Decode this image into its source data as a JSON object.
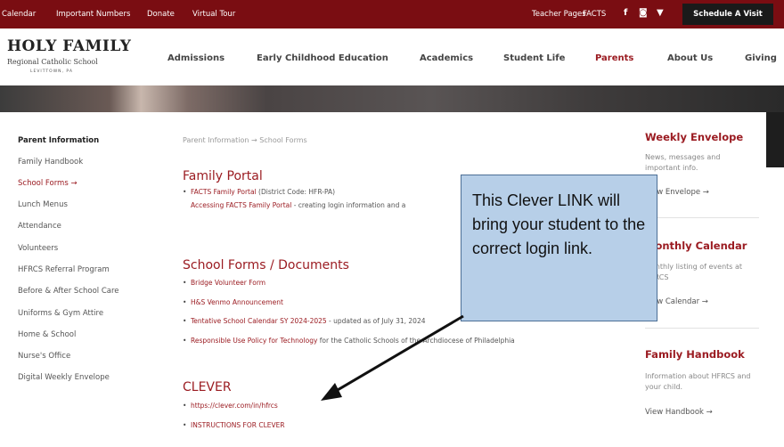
{
  "topbar": {
    "links": [
      "Calendar",
      "Important Numbers",
      "Donate",
      "Virtual Tour"
    ],
    "right_links": [
      "Teacher Pages",
      "FACTS"
    ],
    "social_icons": [
      "facebook-icon",
      "instagram-icon",
      "twitter-icon"
    ],
    "social_glyphs": [
      "f",
      "◙",
      "▼"
    ],
    "cta": "Schedule A Visit"
  },
  "logo": {
    "name": "HOLY FAMILY",
    "subtitle": "Regional Catholic School",
    "location": "LEVITTOWN, PA"
  },
  "nav": [
    "Admissions",
    "Early Childhood Education",
    "Academics",
    "Student Life",
    "Parents",
    "About Us",
    "Giving"
  ],
  "sidebar": {
    "heading": "Parent Information",
    "items": [
      "Family Handbook",
      "School Forms →",
      "Lunch Menus",
      "Attendance",
      "Volunteers",
      "HFRCS Referral Program",
      "Before & After School Care",
      "Uniforms & Gym Attire",
      "Home & School",
      "Nurse's Office",
      "Digital Weekly Envelope"
    ]
  },
  "breadcrumb": {
    "parent": "Parent Information",
    "sep": "→",
    "current": "School Forms"
  },
  "main": {
    "portal": {
      "title": "Family Portal",
      "b1_link": "FACTS Family Portal",
      "b1_text": " (District Code: HFR-PA)",
      "b2_link": "Accessing FACTS Family Portal",
      "b2_text": " - creating login information and a"
    },
    "forms": {
      "title": "School Forms / Documents",
      "b1_link": "Bridge Volunteer Form",
      "b2_link": "H&S Venmo Announcement",
      "b3_link": "Tentative School Calendar SY 2024-2025",
      "b3_text": " - updated as of July 31, 2024",
      "b4_link": "Responsible Use Policy for Technology",
      "b4_text": " for the Catholic Schools of the Archdiocese of Philadelphia"
    },
    "clever": {
      "title": "CLEVER",
      "b1_link": "https://clever.com/in/hfrcs",
      "b2_link": "INSTRUCTIONS FOR CLEVER"
    }
  },
  "right": {
    "envelope": {
      "title": "Weekly Envelope",
      "text": "News, messages and important info.",
      "link": "View Envelope →"
    },
    "calendar": {
      "title": "Monthly Calendar",
      "text": "Monthly listing of events at HFRCS",
      "link": "View Calendar →"
    },
    "handbook": {
      "title": "Family Handbook",
      "text": "Information about HFRCS and your child.",
      "link": "View Handbook →"
    }
  },
  "callout": {
    "text": "This Clever LINK will bring your student to the correct login link."
  },
  "colors": {
    "brand": "#7a0d12",
    "accent": "#9b1c22",
    "callout_fill": "#b7cfe8"
  }
}
